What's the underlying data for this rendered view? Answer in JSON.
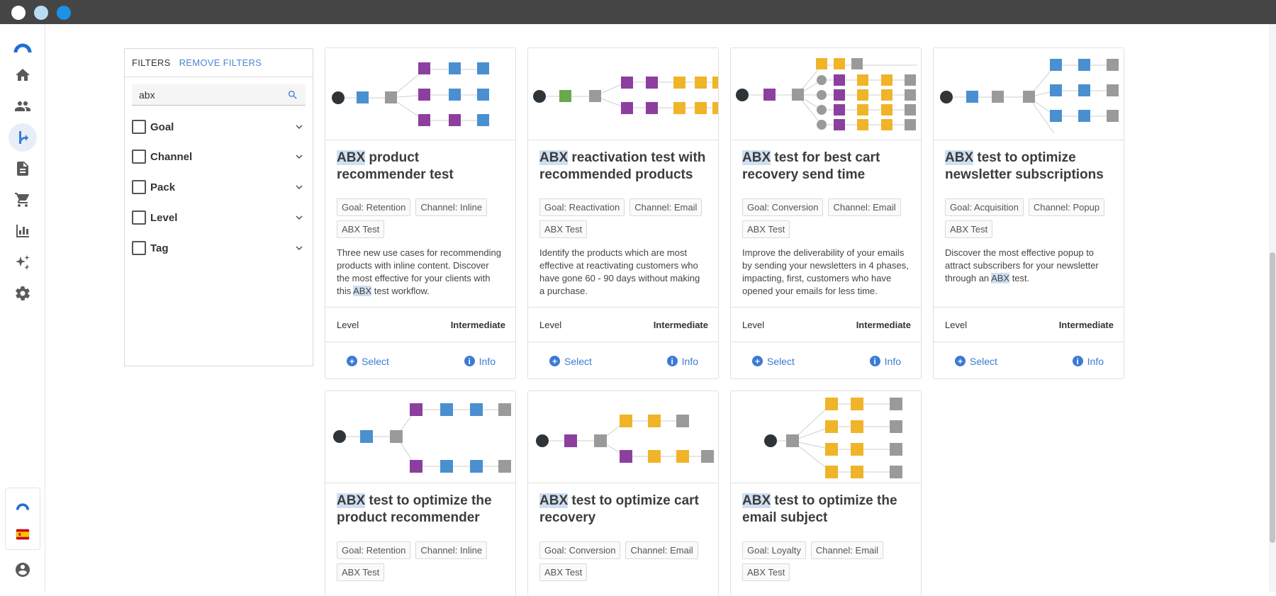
{
  "colors": {
    "accent": "#3b7bd4",
    "highlight": "#cfdff2",
    "purple_node": "#8c3f9e",
    "blue_node": "#4a90d0",
    "yellow_node": "#f0b429",
    "gray_node": "#9a9a9a",
    "green_node": "#6aa84f",
    "start_node": "#2f3438"
  },
  "rail": {
    "items": [
      "home-icon",
      "people-icon",
      "flow-icon",
      "document-icon",
      "cart-icon",
      "chart-icon",
      "sparkle-icon",
      "gear-icon"
    ],
    "bottom": [
      "brand-logo",
      "language-flag-es",
      "account-icon"
    ]
  },
  "filters": {
    "label": "FILTERS",
    "remove_label": "REMOVE FILTERS",
    "search_value": "abx",
    "groups": [
      "Goal",
      "Channel",
      "Pack",
      "Level",
      "Tag"
    ]
  },
  "cards": [
    {
      "title_hl": "ABX",
      "title_rest": " product recommender test",
      "chips": [
        "Goal: Retention",
        "Channel: Inline",
        "ABX Test"
      ],
      "desc_pre": "Three new use cases for recommending products with inline content. Discover the most effective for your clients with this ",
      "desc_hl": "ABX",
      "desc_post": " test workflow.",
      "level_label": "Level",
      "level_value": "Intermediate",
      "select_label": "Select",
      "info_label": "Info"
    },
    {
      "title_hl": "ABX",
      "title_rest": " reactivation test with recommended products",
      "chips": [
        "Goal: Reactivation",
        "Channel: Email",
        "ABX Test"
      ],
      "desc_pre": "Identify the products which are most effective at reactivating customers who have gone 60 - 90 days without making a purchase.",
      "desc_hl": "",
      "desc_post": "",
      "level_label": "Level",
      "level_value": "Intermediate",
      "select_label": "Select",
      "info_label": "Info"
    },
    {
      "title_hl": "ABX",
      "title_rest": " test for best cart recovery send time",
      "chips": [
        "Goal: Conversion",
        "Channel: Email",
        "ABX Test"
      ],
      "desc_pre": "Improve the deliverability of your emails by sending your newsletters in 4 phases, impacting, first, customers who have opened your emails for less time.",
      "desc_hl": "",
      "desc_post": "",
      "level_label": "Level",
      "level_value": "Intermediate",
      "select_label": "Select",
      "info_label": "Info"
    },
    {
      "title_hl": "ABX",
      "title_rest": " test to optimize newsletter subscriptions",
      "chips": [
        "Goal: Acquisition",
        "Channel: Popup",
        "ABX Test"
      ],
      "desc_pre": "Discover the most effective popup to attract subscribers for your newsletter through an ",
      "desc_hl": "ABX",
      "desc_post": " test.",
      "level_label": "Level",
      "level_value": "Intermediate",
      "select_label": "Select",
      "info_label": "Info"
    },
    {
      "title_hl": "ABX",
      "title_rest": " test to optimize the product recommender",
      "chips": [
        "Goal: Retention",
        "Channel: Inline",
        "ABX Test"
      ]
    },
    {
      "title_hl": "ABX",
      "title_rest": " test to optimize cart recovery",
      "chips": [
        "Goal: Conversion",
        "Channel: Email",
        "ABX Test"
      ]
    },
    {
      "title_hl": "ABX",
      "title_rest": " test to optimize the email subject",
      "chips": [
        "Goal: Loyalty",
        "Channel: Email",
        "ABX Test"
      ]
    }
  ]
}
